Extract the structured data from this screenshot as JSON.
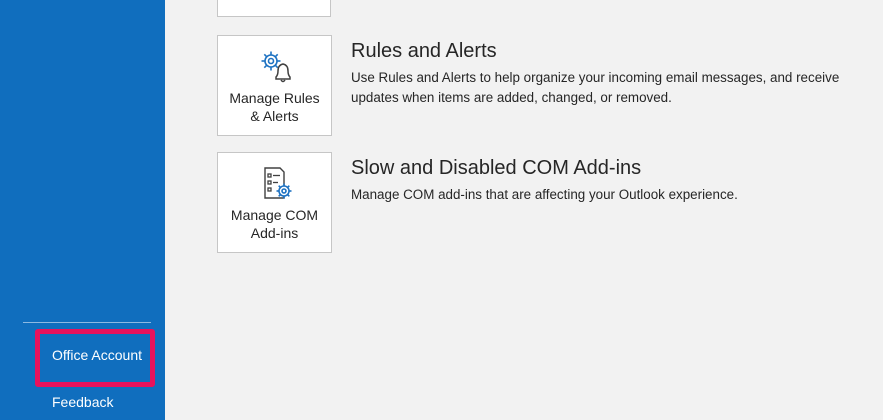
{
  "sidebar": {
    "items": [
      {
        "label": "Office Account"
      },
      {
        "label": "Feedback"
      }
    ],
    "highlight_color": "#e8125c",
    "background_color": "#106ebe"
  },
  "sections": [
    {
      "tile_label": "Manage Rules\n& Alerts",
      "icon": "rules-alerts-gear-bell-icon",
      "title": "Rules and Alerts",
      "description": "Use Rules and Alerts to help organize your incoming email messages, and receive updates when items are added, changed, or removed."
    },
    {
      "tile_label": "Manage COM\nAdd-ins",
      "icon": "com-addins-list-gear-icon",
      "title": "Slow and Disabled COM Add-ins",
      "description": "Manage COM add-ins that are affecting your Outlook experience."
    }
  ]
}
